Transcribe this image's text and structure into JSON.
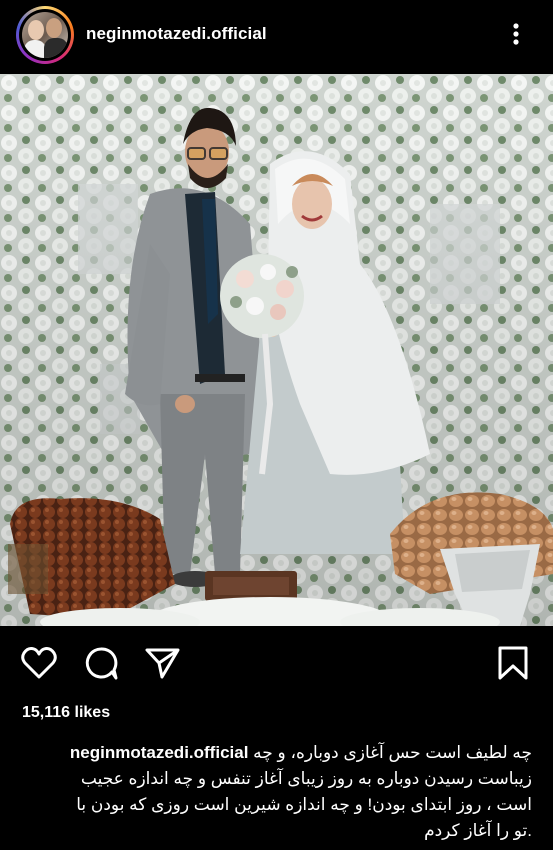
{
  "post": {
    "username": "neginmotazedi.official",
    "likes": "15,116 likes",
    "caption_first": "چه لطیف است حس آغازی دوباره، و چه",
    "caption_lines": [
      "زیباست رسیدن دوباره به روز زیبای آغاز تنفس و چه اندازه عجیب",
      "است ، روز ابتدای بودن! و چه اندازه شیرین است روزی که بودن با",
      ".تو را آغاز کردم"
    ]
  },
  "icons": {
    "more": "more-vertical-icon",
    "like": "heart-icon",
    "comment": "comment-icon",
    "share": "send-icon",
    "save": "bookmark-icon"
  },
  "colors": {
    "background": "#000000",
    "text": "#ffffff"
  }
}
